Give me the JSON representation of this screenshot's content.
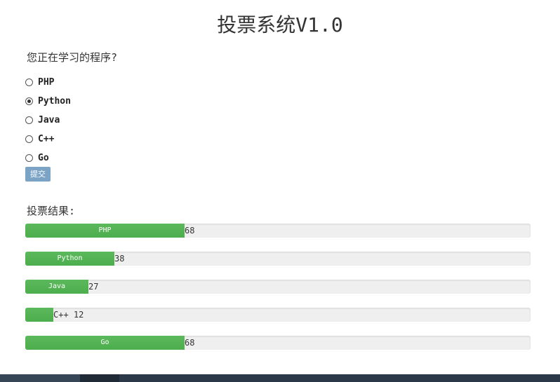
{
  "page": {
    "title": "投票系统V1.0"
  },
  "poll": {
    "question": "您正在学习的程序?",
    "options": [
      {
        "label": "PHP",
        "checked": false
      },
      {
        "label": "Python",
        "checked": true
      },
      {
        "label": "Java",
        "checked": false
      },
      {
        "label": "C++",
        "checked": false
      },
      {
        "label": "Go",
        "checked": false
      }
    ],
    "submit_label": "提交"
  },
  "results": {
    "title": "投票结果:",
    "max_reference": 216,
    "items": [
      {
        "name": "PHP",
        "votes": 68,
        "count_text": "68",
        "fill_color": "#4cae4c"
      },
      {
        "name": "Python",
        "votes": 38,
        "count_text": "38",
        "fill_color": "#4cae4c"
      },
      {
        "name": "Java",
        "votes": 27,
        "count_text": "27",
        "fill_color": "#4cae4c"
      },
      {
        "name": "C++",
        "votes": 12,
        "count_text": "C++ 12",
        "fill_color": "#4cae4c"
      },
      {
        "name": "Go",
        "votes": 68,
        "count_text": "68",
        "fill_color": "#4cae4c"
      }
    ]
  }
}
